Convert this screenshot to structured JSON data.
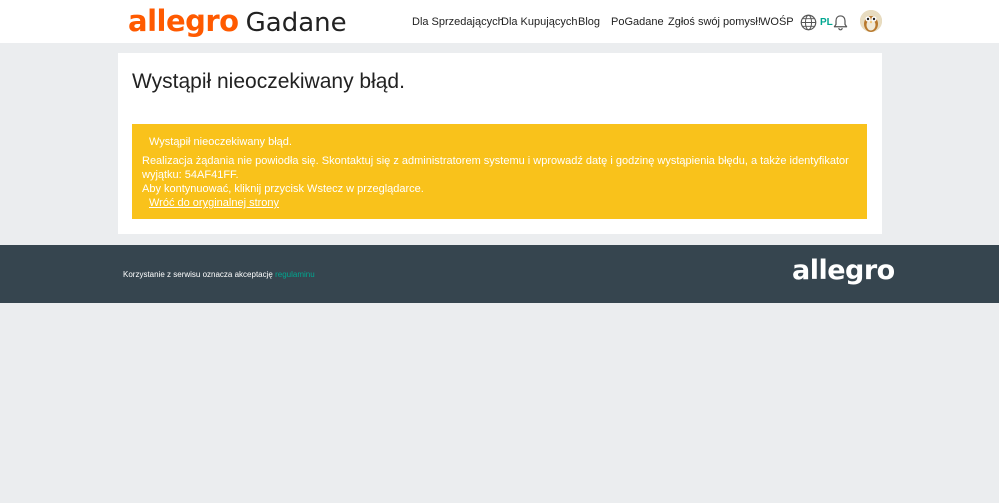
{
  "header": {
    "logo_brand": "allegro",
    "logo_product": "Gadane",
    "nav": [
      {
        "label": "Dla Sprzedających"
      },
      {
        "label": "Dla Kupujących"
      },
      {
        "label": "Blog"
      },
      {
        "label": "PoGadane"
      },
      {
        "label": "Zgłoś swój pomysł!"
      },
      {
        "label": "WOŚP"
      }
    ],
    "language": "PL",
    "icons": {
      "language": "globe-icon",
      "notifications": "bell-icon",
      "user": "avatar"
    }
  },
  "main": {
    "title": "Wystąpił nieoczekiwany błąd.",
    "alert": {
      "title": "Wystąpił nieoczekiwany błąd.",
      "message": "Realizacja żądania nie powiodła się. Skontaktuj się z administratorem systemu i wprowadź datę i godzinę wystąpienia błędu, a także identyfikator wyjątku: 54AF41FF.",
      "message2": "Aby kontynuować, kliknij przycisk Wstecz w przeglądarce.",
      "link": "Wróć do oryginalnej strony"
    }
  },
  "footer": {
    "text": "Korzystanie z serwisu oznacza akceptację",
    "link": "regulaminu",
    "logo": "allegro"
  },
  "colors": {
    "brand_orange": "#ff5a00",
    "accent_teal": "#00a790",
    "alert_yellow": "#f9c21b",
    "footer_bg": "#36454f",
    "page_bg": "#ebedef"
  }
}
